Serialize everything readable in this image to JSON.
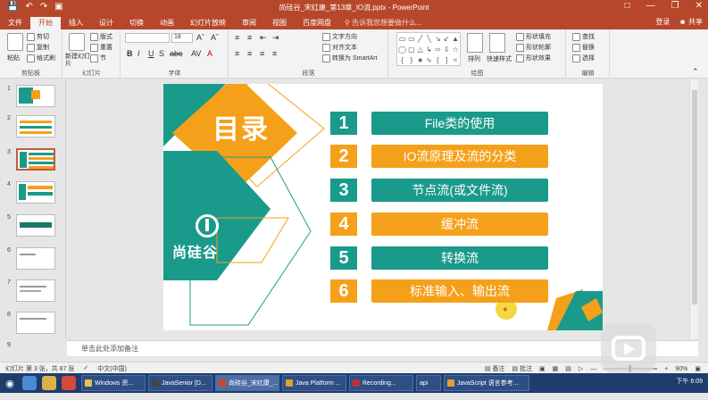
{
  "window": {
    "title": "尚硅谷_宋红康_第13章_IO流.pptx - PowerPoint",
    "login": "登录",
    "share": "共享"
  },
  "tabs": [
    {
      "label": "文件"
    },
    {
      "label": "开始"
    },
    {
      "label": "插入"
    },
    {
      "label": "设计"
    },
    {
      "label": "切换"
    },
    {
      "label": "动画"
    },
    {
      "label": "幻灯片放映"
    },
    {
      "label": "审阅"
    },
    {
      "label": "视图"
    },
    {
      "label": "百度网盘"
    }
  ],
  "tellme": "告诉我您想要做什么...",
  "ribbon": {
    "clipboard": {
      "group": "剪贴板",
      "paste": "粘贴",
      "cut": "剪切",
      "copy": "复制",
      "format_painter": "格式刷"
    },
    "slides": {
      "group": "幻灯片",
      "new_slide": "新建幻灯片",
      "layout": "版式",
      "reset": "重置",
      "section": "节"
    },
    "font": {
      "group": "字体",
      "size": "18"
    },
    "paragraph": {
      "group": "段落",
      "text_direction": "文字方向",
      "align_text": "对齐文本",
      "smartart": "转换为 SmartArt"
    },
    "drawing": {
      "group": "绘图",
      "arrange": "排列",
      "quick_styles": "快速样式",
      "shape_fill": "形状填充",
      "shape_outline": "形状轮廓",
      "shape_effects": "形状效果"
    },
    "editing": {
      "group": "编辑",
      "find": "查找",
      "replace": "替换",
      "select": "选择"
    }
  },
  "thumbnails": [
    {
      "num": "1"
    },
    {
      "num": "2"
    },
    {
      "num": "3"
    },
    {
      "num": "4"
    },
    {
      "num": "5"
    },
    {
      "num": "6"
    },
    {
      "num": "7"
    },
    {
      "num": "8"
    },
    {
      "num": "9"
    }
  ],
  "slide": {
    "heading": "目录",
    "logo_text": "尚硅谷",
    "items": [
      {
        "num": "1",
        "label": "File类的使用"
      },
      {
        "num": "2",
        "label": "IO流原理及流的分类"
      },
      {
        "num": "3",
        "label": "节点流(或文件流)"
      },
      {
        "num": "4",
        "label": "缓冲流"
      },
      {
        "num": "5",
        "label": "转换流"
      },
      {
        "num": "6",
        "label": "标准输入、输出流"
      }
    ]
  },
  "notes": "单击此处添加备注",
  "status": {
    "slide_info": "幻灯片 第 3 张，共 87 张",
    "language": "中文(中国)",
    "notes_btn": "备注",
    "comments_btn": "批注",
    "zoom": "90%"
  },
  "taskbar": {
    "tasks": [
      {
        "label": "Windows 资..."
      },
      {
        "label": "JavaSenior [D..."
      },
      {
        "label": "尚硅谷_宋红康_..."
      },
      {
        "label": "Java Platform ..."
      },
      {
        "label": "Recording..."
      },
      {
        "label": "api"
      },
      {
        "label": "JavaScript 语言参考..."
      }
    ],
    "clock": "下午 6:09"
  },
  "colors": {
    "teal": "#1a9a8a",
    "orange": "#f5a01a",
    "office_red": "#b7472a"
  }
}
